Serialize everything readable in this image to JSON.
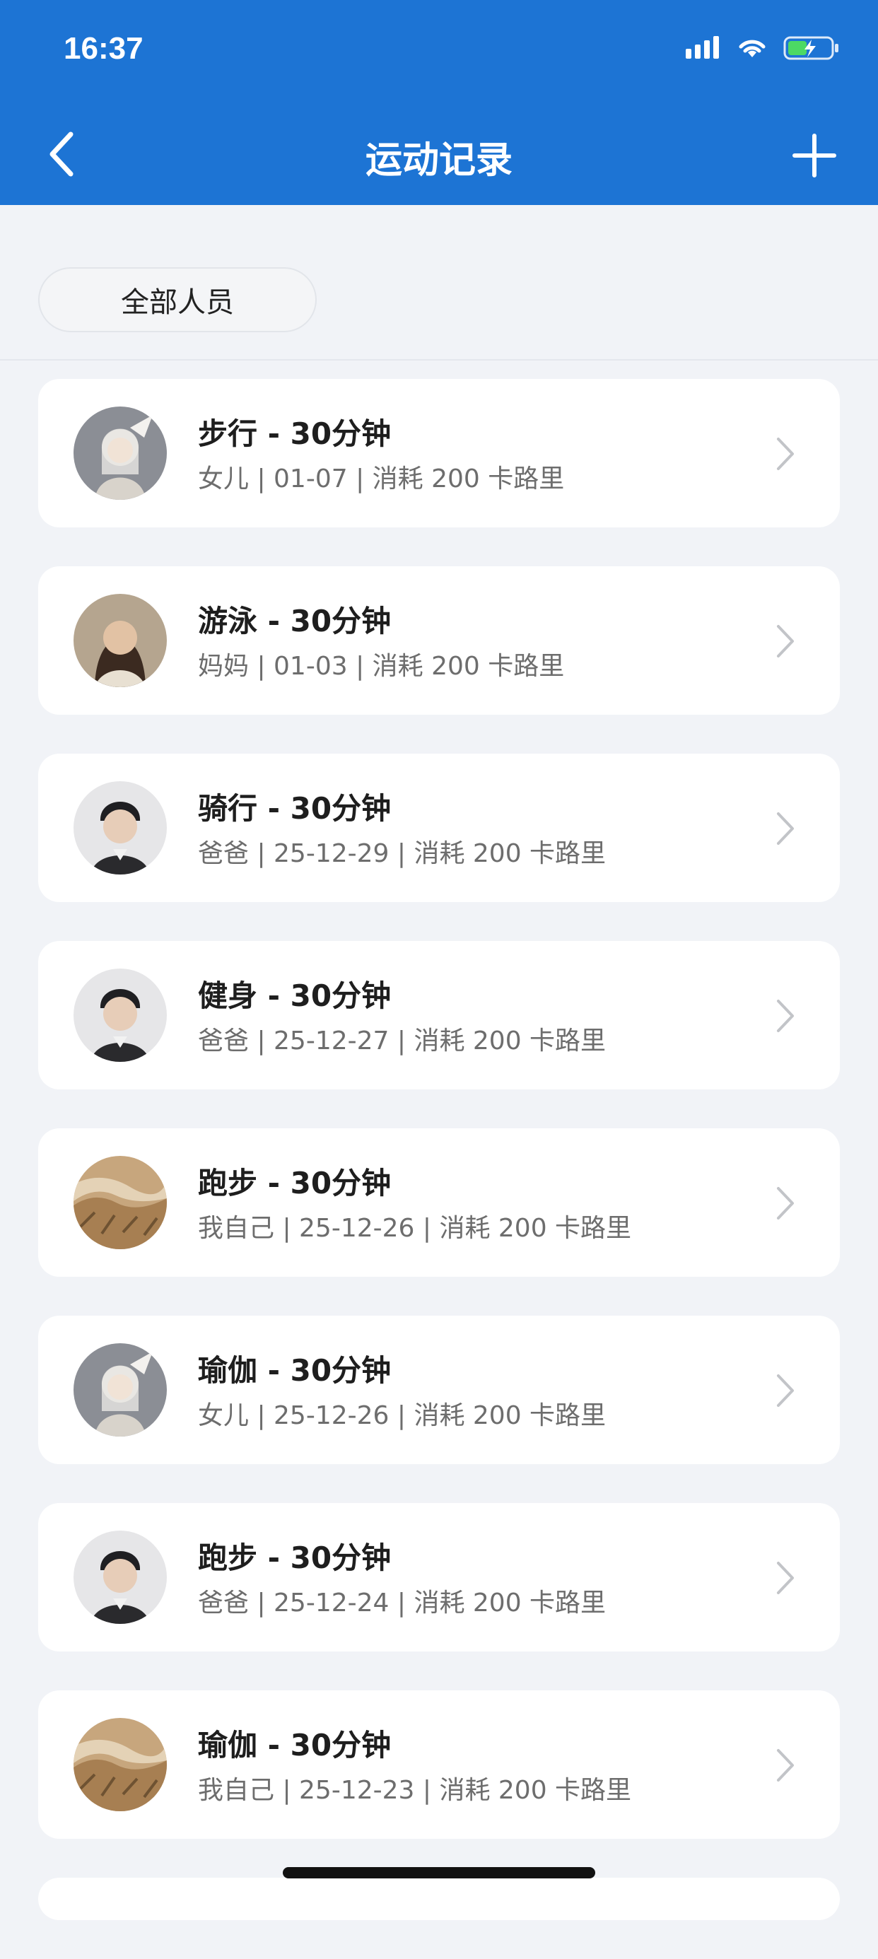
{
  "status_bar": {
    "time": "16:37"
  },
  "nav": {
    "title": "运动记录",
    "back_icon": "chevron-left-icon",
    "add_icon": "plus-icon"
  },
  "filter": {
    "label": "全部人员"
  },
  "records": [
    {
      "title": "步行 - 30分钟",
      "subtitle": "女儿 | 01-07 | 消耗 200 卡路里",
      "avatar": "fantasy-girl-avatar"
    },
    {
      "title": "游泳 - 30分钟",
      "subtitle": "妈妈 | 01-03 | 消耗 200 卡路里",
      "avatar": "woman-avatar"
    },
    {
      "title": "骑行 - 30分钟",
      "subtitle": "爸爸 | 25-12-29 | 消耗 200 卡路里",
      "avatar": "man-avatar"
    },
    {
      "title": "健身 - 30分钟",
      "subtitle": "爸爸 | 25-12-27 | 消耗 200 卡路里",
      "avatar": "man-avatar"
    },
    {
      "title": "跑步 - 30分钟",
      "subtitle": "我自己 | 25-12-26 | 消耗 200 卡路里",
      "avatar": "dry-grass-avatar"
    },
    {
      "title": "瑜伽 - 30分钟",
      "subtitle": "女儿 | 25-12-26 | 消耗 200 卡路里",
      "avatar": "fantasy-girl-avatar"
    },
    {
      "title": "跑步 - 30分钟",
      "subtitle": "爸爸 | 25-12-24 | 消耗 200 卡路里",
      "avatar": "man-avatar"
    },
    {
      "title": "瑜伽 - 30分钟",
      "subtitle": "我自己 | 25-12-23 | 消耗 200 卡路里",
      "avatar": "dry-grass-avatar"
    }
  ],
  "colors": {
    "accent": "#1d74d4",
    "background": "#f1f3f7",
    "card": "#ffffff"
  }
}
